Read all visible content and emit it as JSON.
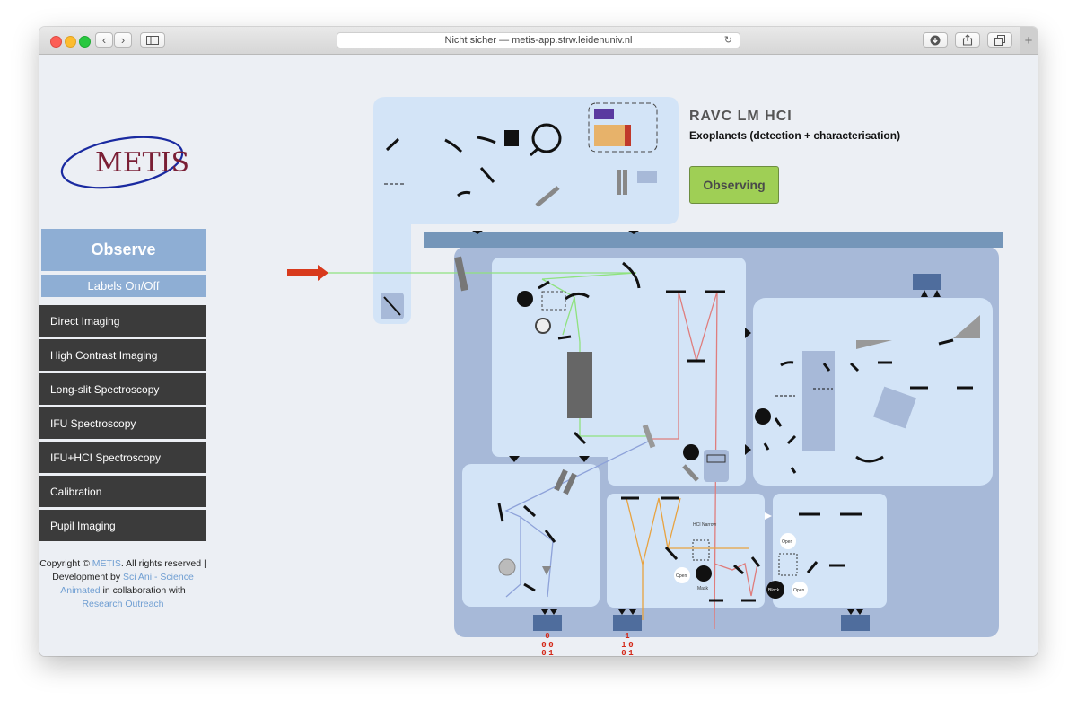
{
  "browser": {
    "address": "Nicht sicher — metis-app.strw.leidenuniv.nl",
    "back_glyph": "‹",
    "forward_glyph": "›",
    "reload_glyph": "↻",
    "new_tab_glyph": "+"
  },
  "logo": {
    "text": "METIS"
  },
  "sidebar": {
    "observe_label": "Observe",
    "labels_toggle": "Labels On/Off",
    "items": [
      {
        "label": "Direct Imaging"
      },
      {
        "label": "High Contrast Imaging"
      },
      {
        "label": "Long-slit Spectroscopy"
      },
      {
        "label": "IFU Spectroscopy"
      },
      {
        "label": "IFU+HCI Spectroscopy"
      },
      {
        "label": "Calibration"
      },
      {
        "label": "Pupil Imaging"
      }
    ],
    "copyright": {
      "prefix": "Copyright © ",
      "metis_link": "METIS",
      "middle": ". All rights reserved | Development by ",
      "sciani_link": "Sci Ani - Science Animated",
      "middle2": " in collaboration with ",
      "research_link": "Research Outreach"
    }
  },
  "mode": {
    "title": "RAVC LM HCI",
    "subtitle": "Exoplanets (detection + characterisation)",
    "status_button": "Observing"
  },
  "diagram": {
    "labels": {
      "hci_narrow": "HCI Narrow",
      "open1": "Open",
      "mask": "Mask",
      "open2": "Open",
      "open3": "Open",
      "block": "Block"
    },
    "data_stream": [
      "0",
      "1",
      "0",
      "0",
      "0",
      "1",
      "1",
      "0",
      "0",
      "1",
      "1",
      "0"
    ],
    "colors": {
      "panel_dark": "#a7b9d8",
      "panel_light": "#d3e4f7",
      "beam_green": "#8fe27f",
      "beam_red": "#df7d7d",
      "beam_blue": "#8ea2d9",
      "beam_orange": "#e8a23f",
      "arrow_red": "#d83a1c",
      "data_red": "#d42a1a",
      "detector": "#4f6d9d"
    }
  }
}
